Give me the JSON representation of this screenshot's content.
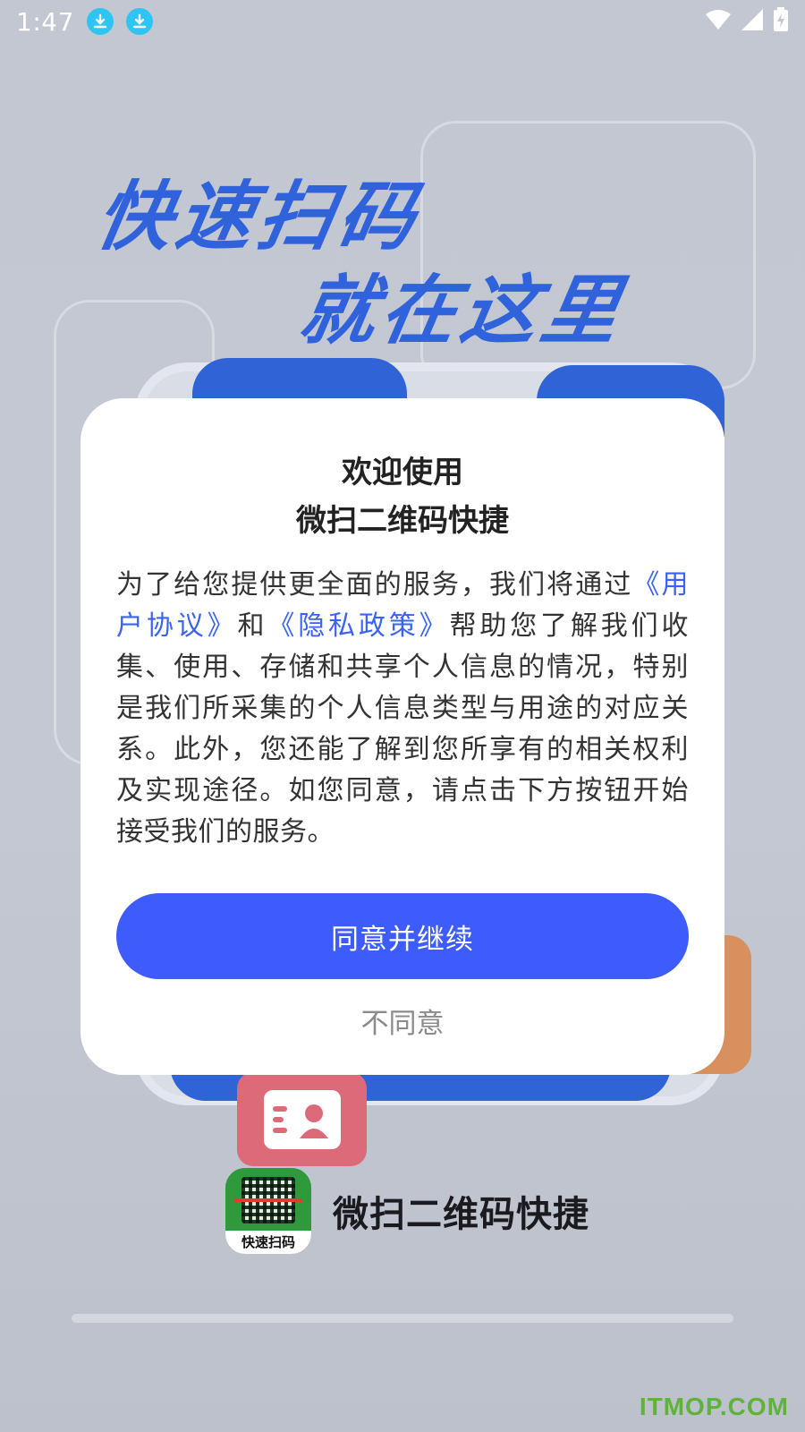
{
  "status_bar": {
    "time": "1:47",
    "icons": [
      "download-icon",
      "download-icon",
      "wifi-icon",
      "signal-icon",
      "battery-charging-icon"
    ]
  },
  "splash": {
    "hero_line_1": "快速扫码",
    "hero_line_2": "就在这里",
    "brand_name": "微扫二维码快捷",
    "logo_caption": "快速扫码"
  },
  "dialog": {
    "title_line_1": "欢迎使用",
    "title_line_2": "微扫二维码快捷",
    "body_part_1": "为了给您提供更全面的服务，我们将通过",
    "user_agreement_link": "《用户协议》",
    "body_part_2": "和",
    "privacy_policy_link": "《隐私政策》",
    "body_part_3": "帮助您了解我们收集、使用、存储和共享个人信息的情况，特别是我们所采集的个人信息类型与用途的对应关系。此外，您还能了解到您所享有的相关权利及实现途径。如您同意，请点击下方按钮开始接受我们的服务。",
    "agree_button": "同意并继续",
    "disagree_button": "不同意"
  },
  "watermark": "ITMOP.COM",
  "colors": {
    "primary_button": "#3d5cfb",
    "link": "#3a63f2",
    "hero_text": "#2f62db",
    "disagree_text": "#8b8b8b"
  }
}
